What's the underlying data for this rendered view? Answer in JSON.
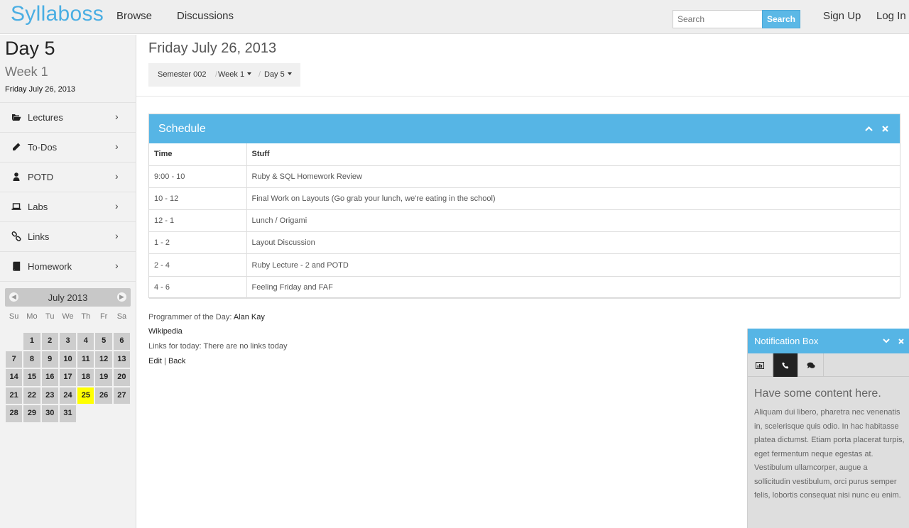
{
  "navbar": {
    "brand": "Syllaboss",
    "links": [
      "Browse",
      "Discussions"
    ],
    "search_placeholder": "Search",
    "search_button": "Search",
    "sign_up": "Sign Up",
    "log_in": "Log In"
  },
  "sidebar": {
    "day": "Day 5",
    "week": "Week 1",
    "date": "Friday July 26, 2013",
    "items": [
      {
        "label": "Lectures",
        "icon": "folder-open-icon"
      },
      {
        "label": "To-Dos",
        "icon": "pencil-icon"
      },
      {
        "label": "POTD",
        "icon": "user-icon"
      },
      {
        "label": "Labs",
        "icon": "laptop-icon"
      },
      {
        "label": "Links",
        "icon": "link-icon"
      },
      {
        "label": "Homework",
        "icon": "book-icon"
      }
    ],
    "chevron": "›"
  },
  "calendar": {
    "month": "July 2013",
    "weekdays": [
      "Su",
      "Mo",
      "Tu",
      "We",
      "Th",
      "Fr",
      "Sa"
    ],
    "first_weekday": 1,
    "days_in_month": 31,
    "highlighted_day": 25,
    "highlight_color": "#ffff00"
  },
  "main": {
    "title": "Friday July 26, 2013",
    "breadcrumb": {
      "semester": "Semester 002",
      "week": "Week 1",
      "day": "Day 5"
    },
    "schedule": {
      "title": "Schedule",
      "headers": [
        "Time",
        "Stuff"
      ],
      "rows": [
        [
          "9:00 - 10",
          "Ruby & SQL Homework Review"
        ],
        [
          "10 - 12",
          "Final Work on Layouts (Go grab your lunch, we're eating in the school)"
        ],
        [
          "12 - 1",
          "Lunch / Origami"
        ],
        [
          "1 - 2",
          "Layout Discussion"
        ],
        [
          "2 - 4",
          "Ruby Lecture - 2 and POTD"
        ],
        [
          "4 - 6",
          "Feeling Friday and FAF"
        ]
      ]
    },
    "potd_label": "Programmer of the Day:",
    "potd_name": "Alan Kay",
    "wikipedia": "Wikipedia",
    "links_today": "Links for today: There are no links today",
    "edit": "Edit",
    "sep": "|",
    "back": "Back"
  },
  "notification": {
    "title": "Notification Box",
    "tabs": [
      "chart-icon",
      "phone-icon",
      "comments-icon"
    ],
    "active_tab": 1,
    "heading": "Have some content here.",
    "body": "Aliquam dui libero, pharetra nec venenatis in, scelerisque quis odio. In hac habitasse platea dictumst. Etiam porta placerat turpis, eget fermentum neque egestas at. Vestibulum ullamcorper, augue a sollicitudin vestibulum, orci purus semper felis, lobortis consequat nisi nunc eu enim."
  },
  "colors": {
    "brand": "#4aaee3",
    "panel_header": "#56b5e5",
    "search_button": "#5bb8e6"
  }
}
